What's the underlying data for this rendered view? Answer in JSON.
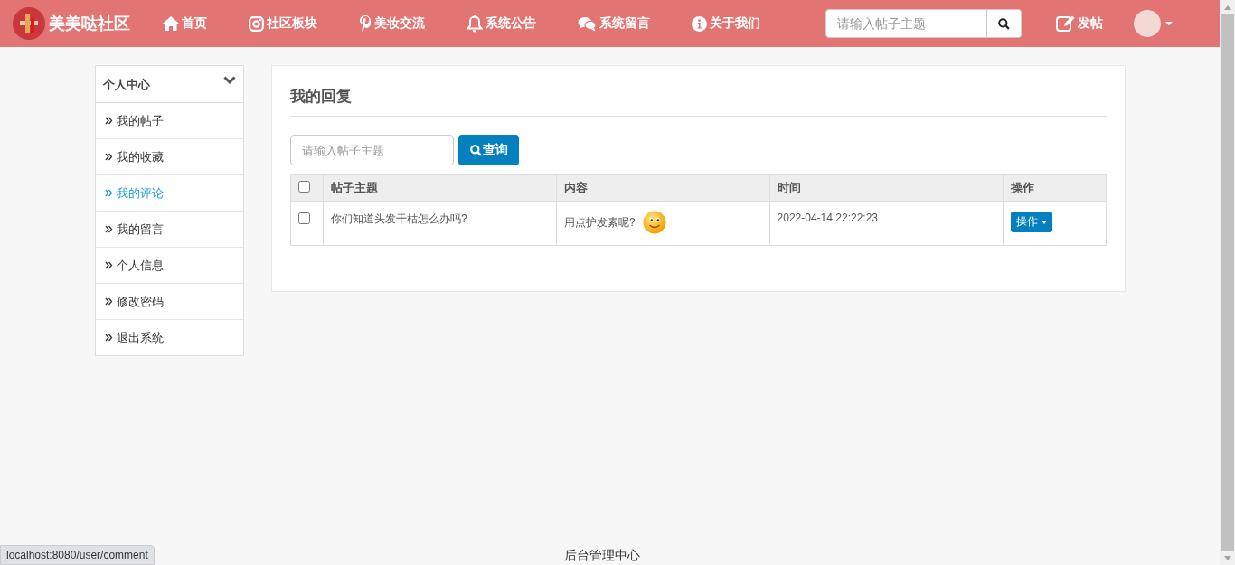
{
  "brand": {
    "name": "美美哒社区"
  },
  "nav": [
    {
      "kind": "home",
      "label": "首页"
    },
    {
      "kind": "instagram",
      "label": "社区板块"
    },
    {
      "kind": "pinterest",
      "label": "美妆交流"
    },
    {
      "kind": "bell",
      "label": "系统公告"
    },
    {
      "kind": "chat",
      "label": "系统留言"
    },
    {
      "kind": "info",
      "label": "关于我们"
    }
  ],
  "search": {
    "placeholder": "请输入帖子主题"
  },
  "post_button": "发帖",
  "sidebar": {
    "title": "个人中心",
    "expanded": true,
    "items": [
      {
        "label": "我的帖子",
        "selected": false
      },
      {
        "label": "我的收藏",
        "selected": false
      },
      {
        "label": "我的评论",
        "selected": true
      },
      {
        "label": "我的留言",
        "selected": false
      },
      {
        "label": "个人信息",
        "selected": false
      },
      {
        "label": "修改密码",
        "selected": false
      },
      {
        "label": "退出系统",
        "selected": false
      }
    ]
  },
  "panel": {
    "title": "我的回复",
    "search": {
      "placeholder": "请输入帖子主题",
      "button": "查询"
    },
    "table": {
      "all_checked": false,
      "columns": [
        "帖子主题",
        "内容",
        "时间",
        "操作"
      ],
      "rows": [
        {
          "checked": false,
          "topic": "你们知道头发干枯怎么办吗?",
          "content": "用点护发素呢?",
          "emoji": true,
          "time": "2022-04-14 22:22:23",
          "action": "操作"
        }
      ]
    }
  },
  "footer": "后台管理中心",
  "status_bar": "localhost:8080/user/comment"
}
